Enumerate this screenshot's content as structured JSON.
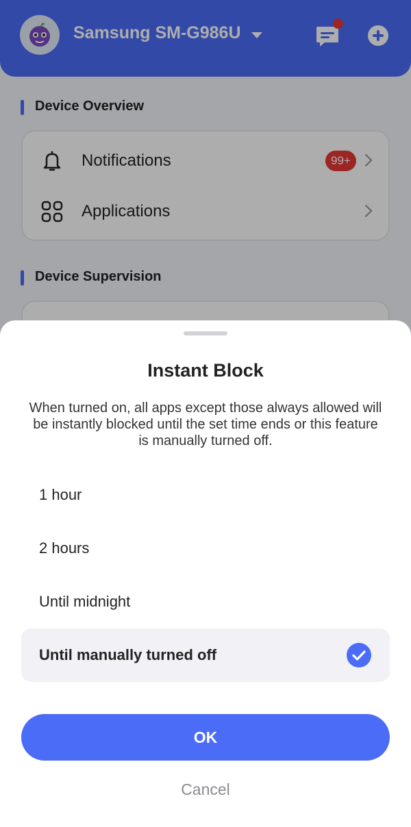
{
  "header": {
    "device_name": "Samsung SM-G986U",
    "icons": {
      "avatar": "grape-avatar-icon",
      "messages": "message-icon",
      "add": "plus-circle-icon",
      "dropdown": "caret-down-icon"
    },
    "accent_color": "#4a6cf7"
  },
  "overview": {
    "title": "Device Overview",
    "items": [
      {
        "label": "Notifications",
        "icon": "bell-icon",
        "badge": "99+"
      },
      {
        "label": "Applications",
        "icon": "apps-grid-icon"
      }
    ]
  },
  "supervision": {
    "title": "Device Supervision"
  },
  "sheet": {
    "title": "Instant Block",
    "description": "When turned on, all apps except those always allowed will be instantly blocked until the set time ends or this feature is manually turned off.",
    "options": [
      {
        "label": "1 hour",
        "selected": false
      },
      {
        "label": "2 hours",
        "selected": false
      },
      {
        "label": "Until midnight",
        "selected": false
      },
      {
        "label": "Until manually turned off",
        "selected": true
      }
    ],
    "ok_label": "OK",
    "cancel_label": "Cancel"
  }
}
